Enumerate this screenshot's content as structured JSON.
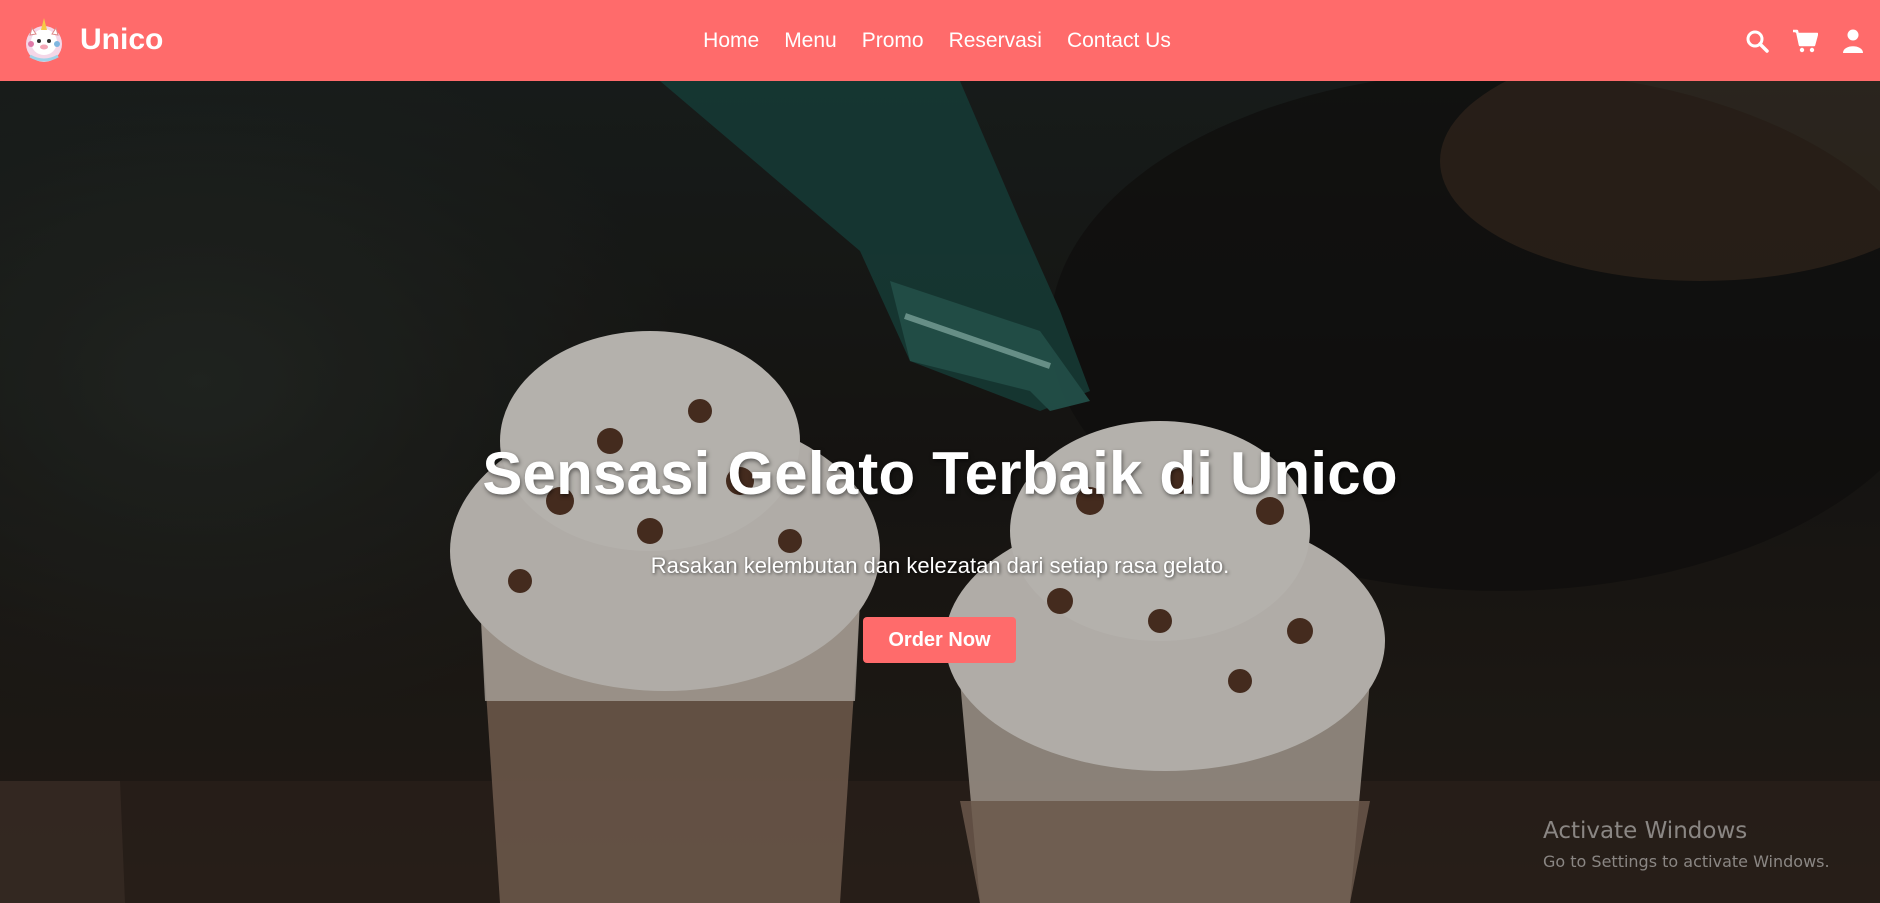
{
  "navbar": {
    "brand_name": "Unico",
    "links": [
      {
        "label": "Home"
      },
      {
        "label": "Menu"
      },
      {
        "label": "Promo"
      },
      {
        "label": "Reservasi"
      },
      {
        "label": "Contact Us"
      }
    ],
    "icons": [
      "search-icon",
      "cart-icon",
      "user-icon"
    ]
  },
  "hero": {
    "title": "Sensasi Gelato Terbaik di Unico",
    "subtitle": "Rasakan kelembutan dan kelezatan dari setiap rasa gelato.",
    "cta_label": "Order Now"
  },
  "watermark": {
    "title": "Activate Windows",
    "subtitle": "Go to Settings to activate Windows."
  },
  "colors": {
    "navbar": "#ff6b6b",
    "button": "#ff6b6b",
    "text": "#ffffff"
  }
}
